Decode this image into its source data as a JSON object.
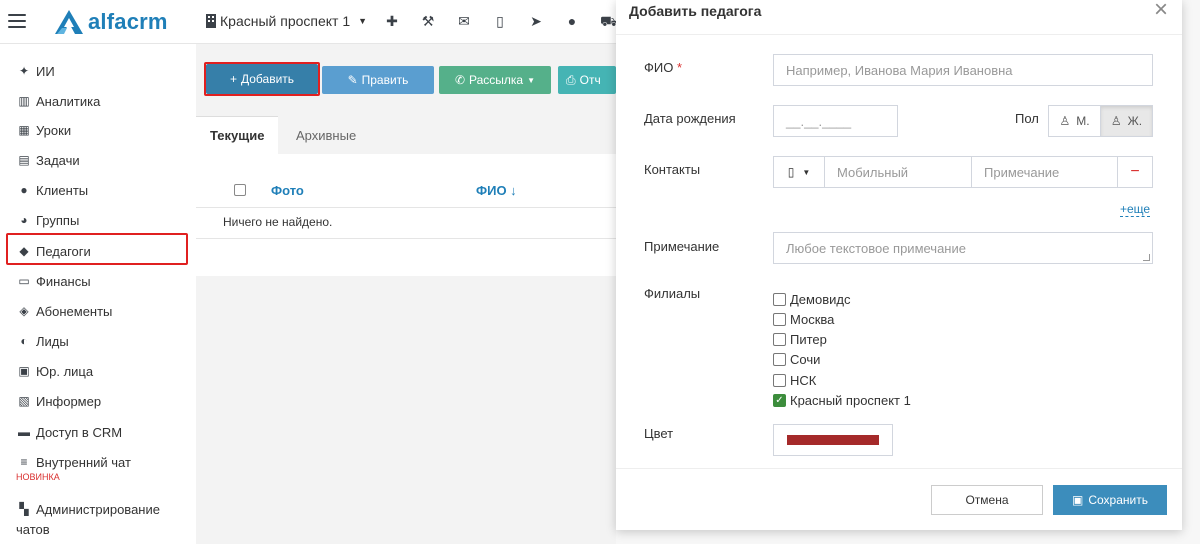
{
  "header": {
    "brand": "alfacrm",
    "branch": "Красный проспект 1",
    "icons": [
      "plus-icon",
      "wrench-icon",
      "envelope-icon",
      "mobile-icon",
      "telegram-icon",
      "circle-icon",
      "cart-icon"
    ]
  },
  "sidebar": {
    "items": [
      {
        "label": "ИИ",
        "icon": "sparkle-icon"
      },
      {
        "label": "Аналитика",
        "icon": "columns-icon"
      },
      {
        "label": "Уроки",
        "icon": "calendar-icon"
      },
      {
        "label": "Задачи",
        "icon": "clipboard-icon"
      },
      {
        "label": "Клиенты",
        "icon": "user-icon"
      },
      {
        "label": "Группы",
        "icon": "users-icon"
      },
      {
        "label": "Педагоги",
        "icon": "graduation-cap-icon"
      },
      {
        "label": "Финансы",
        "icon": "money-icon"
      },
      {
        "label": "Абонементы",
        "icon": "tag-icon"
      },
      {
        "label": "Лиды",
        "icon": "user-plus-icon"
      },
      {
        "label": "Юр. лица",
        "icon": "briefcase-icon"
      },
      {
        "label": "Информер",
        "icon": "newspaper-icon"
      },
      {
        "label": "Доступ в CRM",
        "icon": "lock-icon"
      },
      {
        "label": "Внутренний чат",
        "icon": "chat-icon"
      },
      {
        "label": "Администрирование",
        "icon": "comments-icon"
      }
    ],
    "new_badge": "новинка",
    "admin_sub": "чатов"
  },
  "toolbar": {
    "add": "Добавить",
    "edit": "Править",
    "mailing": "Рассылка",
    "report": "Отч"
  },
  "tabs": [
    "Текущие",
    "Архивные"
  ],
  "table": {
    "columns": [
      "Фото",
      "ФИО ↓"
    ],
    "empty": "Ничего не найдено."
  },
  "modal": {
    "title": "Добавить педагога",
    "fio_label": "ФИО",
    "fio_placeholder": "Например, Иванова Мария Ивановна",
    "birth_label": "Дата рождения",
    "birth_placeholder": "__.__.____",
    "gender_label": "Пол",
    "gender_m": "М.",
    "gender_f": "Ж.",
    "contacts_label": "Контакты",
    "mobile_placeholder": "Мобильный",
    "note_placeholder": "Примечание",
    "more": "+еще",
    "comment_label": "Примечание",
    "comment_placeholder": "Любое текстовое примечание",
    "branches_label": "Филиалы",
    "branches": [
      {
        "label": "Демовидс",
        "checked": false
      },
      {
        "label": "Москва",
        "checked": false
      },
      {
        "label": "Питер",
        "checked": false
      },
      {
        "label": "Сочи",
        "checked": false
      },
      {
        "label": "НСК",
        "checked": false
      },
      {
        "label": "Красный проспект 1",
        "checked": true
      }
    ],
    "color_label": "Цвет",
    "color_value": "#a52a2a",
    "cancel": "Отмена",
    "save": "Сохранить"
  },
  "colors": {
    "primary": "#367fa9",
    "highlight": "#e02020",
    "save": "#3c8dbc"
  }
}
